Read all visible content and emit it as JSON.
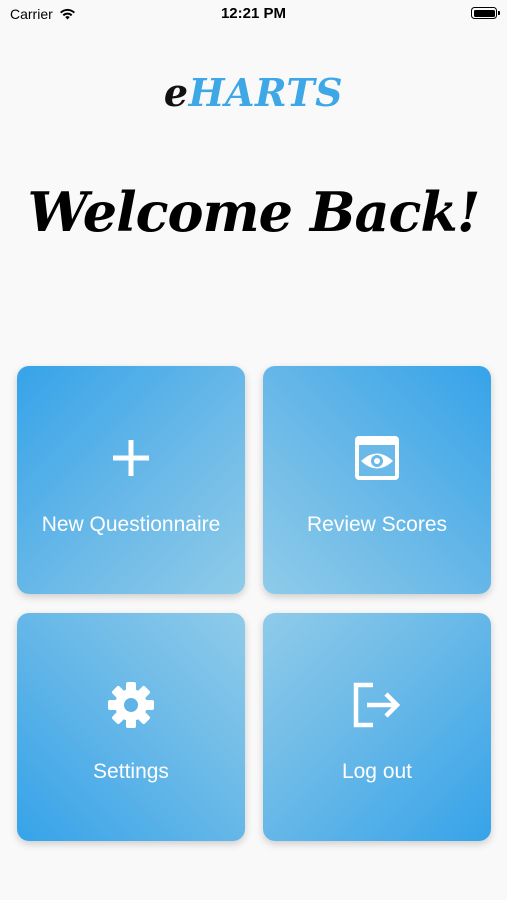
{
  "status_bar": {
    "carrier": "Carrier",
    "time": "12:21 PM"
  },
  "logo": {
    "prefix": "e",
    "name": "HARTS"
  },
  "welcome": "Welcome Back!",
  "tiles": [
    {
      "label": "New Questionnaire",
      "icon": "plus-icon"
    },
    {
      "label": "Review Scores",
      "icon": "eye-icon"
    },
    {
      "label": "Settings",
      "icon": "gear-icon"
    },
    {
      "label": "Log out",
      "icon": "logout-icon"
    }
  ],
  "colors": {
    "accent": "#3ea7e6",
    "tile_dark": "#36a3e9",
    "tile_light": "#8fcbe9",
    "background": "#f9f9f9"
  }
}
